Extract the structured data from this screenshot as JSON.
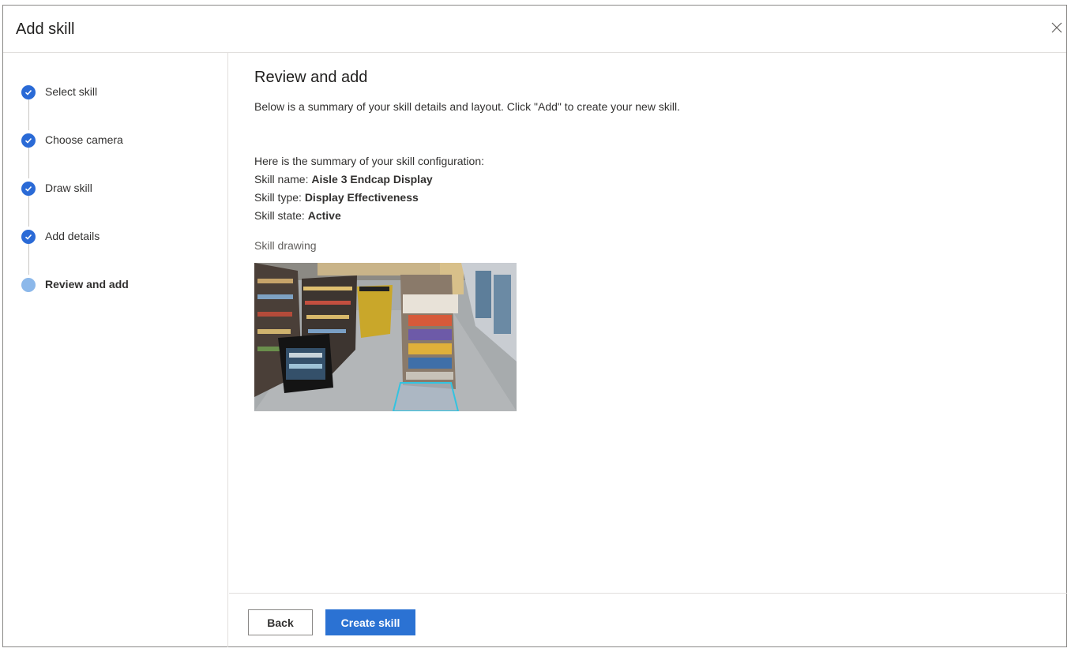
{
  "dialog": {
    "title": "Add skill",
    "close_icon": "close-icon"
  },
  "steps": [
    {
      "label": "Select skill",
      "state": "completed",
      "icon": "check-icon"
    },
    {
      "label": "Choose camera",
      "state": "completed",
      "icon": "check-icon"
    },
    {
      "label": "Draw skill",
      "state": "completed",
      "icon": "check-icon"
    },
    {
      "label": "Add details",
      "state": "completed",
      "icon": "check-icon"
    },
    {
      "label": "Review and add",
      "state": "current"
    }
  ],
  "main": {
    "heading": "Review and add",
    "description": "Below is a summary of your skill details and layout. Click \"Add\" to create your new skill.",
    "summary_intro": "Here is the summary of your skill configuration:",
    "fields": [
      {
        "label": "Skill name: ",
        "value": "Aisle 3 Endcap Display"
      },
      {
        "label": "Skill type: ",
        "value": "Display Effectiveness"
      },
      {
        "label": "Skill state: ",
        "value": "Active"
      }
    ],
    "drawing_label": "Skill drawing",
    "drawing_image": "store-aisle-camera-view"
  },
  "footer": {
    "back_label": "Back",
    "create_label": "Create skill"
  },
  "colors": {
    "accent": "#2b72d3",
    "completed_step": "#2a6ad6",
    "current_step": "#8cb8ea",
    "zone_outline": "#33c3e0"
  }
}
